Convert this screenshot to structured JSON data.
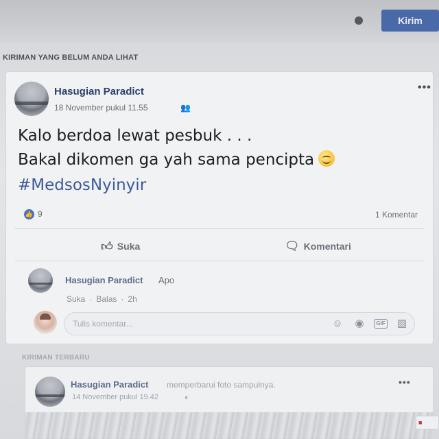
{
  "topbar": {
    "send_label": "Kirim"
  },
  "feed": {
    "unseen_label": "KIRIMAN YANG BELUM ANDA LIHAT",
    "recent_label": "KIRIMAN TERBARU"
  },
  "post": {
    "author": "Hasugian Paradict",
    "timestamp": "18 November pukul 11.55",
    "text_line1": "Kalo berdoa lewat pesbuk . . .",
    "text_line2": "Bakal dikomen ga yah sama pencipta",
    "hashtag": "#MedsosNyinyir",
    "like_count": "9",
    "comment_count": "1 Komentar",
    "like_label": "Suka",
    "comment_label": "Komentari"
  },
  "comment": {
    "author": "Hasugian Paradict",
    "text": "Apo",
    "action_like": "Suka",
    "action_reply": "Balas",
    "age": "2h"
  },
  "composer": {
    "placeholder": "Tulis komentar..."
  },
  "post2": {
    "author": "Hasugian Paradict",
    "action": "memperbarui foto sampulnya.",
    "timestamp": "14 November pukul 19.42"
  },
  "icons": {
    "audience": "friends-icon",
    "more": "more-options-icon",
    "like": "thumbs-up-icon",
    "comment": "speech-bubble-icon",
    "composer_tools": [
      "emoji-icon",
      "camera-icon",
      "gif-icon",
      "sticker-icon"
    ],
    "globe": "globe-icon"
  },
  "colors": {
    "brand_blue": "#4a69a8",
    "author_name": "#2c3e6b",
    "hashtag": "#3b5998"
  }
}
